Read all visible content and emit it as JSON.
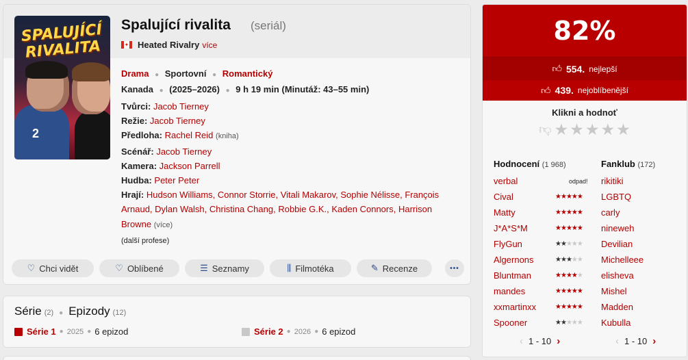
{
  "film": {
    "title": "Spalující rivalita",
    "type": "(seriál)",
    "original_title": "Heated Rivalry",
    "original_more": "více",
    "flag": "canada",
    "poster_text": "SPALUJÍCÍ RIVALITA",
    "genres": [
      "Drama",
      "Sportovní",
      "Romantický"
    ],
    "country": "Kanada",
    "years": "(2025–2026)",
    "runtime": "9 h 19 min (Minutáž: 43–55 min)"
  },
  "creators": {
    "tvurci_label": "Tvůrci:",
    "tvurci": "Jacob Tierney",
    "rezie_label": "Režie:",
    "rezie": "Jacob Tierney",
    "predloha_label": "Předloha:",
    "predloha": "Rachel Reid",
    "predloha_note": "(kniha)",
    "scenar_label": "Scénář:",
    "scenar": "Jacob Tierney",
    "kamera_label": "Kamera:",
    "kamera": "Jackson Parrell",
    "hudba_label": "Hudba:",
    "hudba": "Peter Peter",
    "hraji_label": "Hrají:",
    "hraji": [
      "Hudson Williams",
      "Connor Storrie",
      "Vitali Makarov",
      "Sophie Nélisse",
      "François Arnaud",
      "Dylan Walsh",
      "Christina Chang",
      "Robbie G.K.",
      "Kaden Connors",
      "Harrison Browne"
    ],
    "hraji_more": "(více)",
    "dalsi": "(další profese)"
  },
  "actions": {
    "watch": "Chci vidět",
    "favorite": "Oblíbené",
    "lists": "Seznamy",
    "library": "Filmotéka",
    "review": "Recenze",
    "more": "•••"
  },
  "seasons": {
    "series_label": "Série",
    "series_count": "(2)",
    "episodes_label": "Epizody",
    "episodes_count": "(12)",
    "items": [
      {
        "name": "Série 1",
        "year": "2025",
        "episodes": "6 epizod",
        "color": "#b80000"
      },
      {
        "name": "Série 2",
        "year": "2026",
        "episodes": "6 epizod",
        "color": "#c8c8c8"
      }
    ]
  },
  "rating": {
    "percent": "82%",
    "best_count": "554.",
    "best_label": "nejlepší",
    "unloved_count": "439.",
    "unloved_label": "nejoblíbenější",
    "prompt": "Klikni a hodnoť",
    "accent": "#b80000",
    "ratings_label": "Hodnocení",
    "ratings_count": "(1 968)",
    "fanclub_label": "Fanklub",
    "fanclub_count": "(172)",
    "ratings": [
      {
        "user": "verbal",
        "stars": 0,
        "text": "odpad!"
      },
      {
        "user": "Cival",
        "stars": 5
      },
      {
        "user": "Matty",
        "stars": 5
      },
      {
        "user": "J*A*S*M",
        "stars": 5
      },
      {
        "user": "FlyGun",
        "stars": 2,
        "dark": true
      },
      {
        "user": "Algernons",
        "stars": 3,
        "dark": true
      },
      {
        "user": "Bluntman",
        "stars": 4
      },
      {
        "user": "mandes",
        "stars": 5
      },
      {
        "user": "xxmartinxx",
        "stars": 5
      },
      {
        "user": "Spooner",
        "stars": 2,
        "dark": true
      }
    ],
    "fanclub": [
      "rikitiki",
      "LGBTQ",
      "carly",
      "nineweh",
      "Devilian",
      "Michelleee",
      "elisheva",
      "Mishel",
      "Madden",
      "Kubulla"
    ],
    "pager_ratings": "1 - 10",
    "pager_fanclub": "1 - 10"
  }
}
